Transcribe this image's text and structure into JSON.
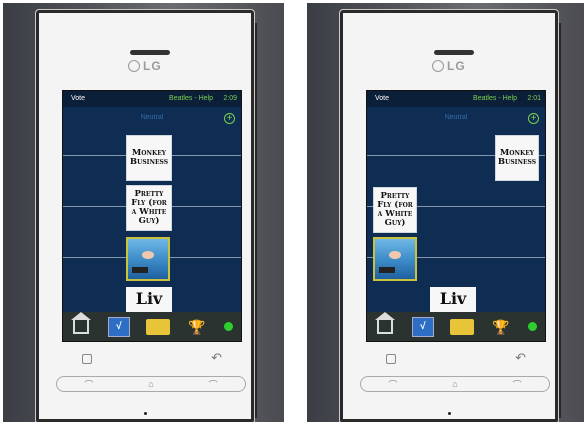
{
  "photos": [
    {
      "brand": "LG",
      "status": {
        "left": "Vote",
        "center": "Beatles - Help",
        "time": "2:09"
      },
      "neutral_label": "Neutral",
      "add_icon": "plus-circle-icon",
      "cards": [
        {
          "text": "Monkey Business"
        },
        {
          "text": "Pretty Fly (for a White Guy)"
        }
      ],
      "album": {
        "description": "album-art"
      },
      "bottom_card": "Liv",
      "toolbar_icons": [
        "home-icon",
        "vote-check-icon",
        "folder-icon",
        "trophy-icon",
        "status-dot-icon"
      ]
    },
    {
      "brand": "LG",
      "status": {
        "left": "Vote",
        "center": "Beatles - Help",
        "time": "2:01"
      },
      "neutral_label": "Neutral",
      "add_icon": "plus-circle-icon",
      "cards": [
        {
          "text": "Monkey Business"
        },
        {
          "text": "Pretty Fly (for a White Guy)"
        }
      ],
      "album": {
        "description": "album-art"
      },
      "bottom_card": "Liv",
      "toolbar_icons": [
        "home-icon",
        "vote-check-icon",
        "folder-icon",
        "trophy-icon",
        "status-dot-icon"
      ]
    }
  ],
  "colors": {
    "screen": "#0f2d52",
    "accent_green": "#7ccf52",
    "toolbar": "#2b3330"
  }
}
